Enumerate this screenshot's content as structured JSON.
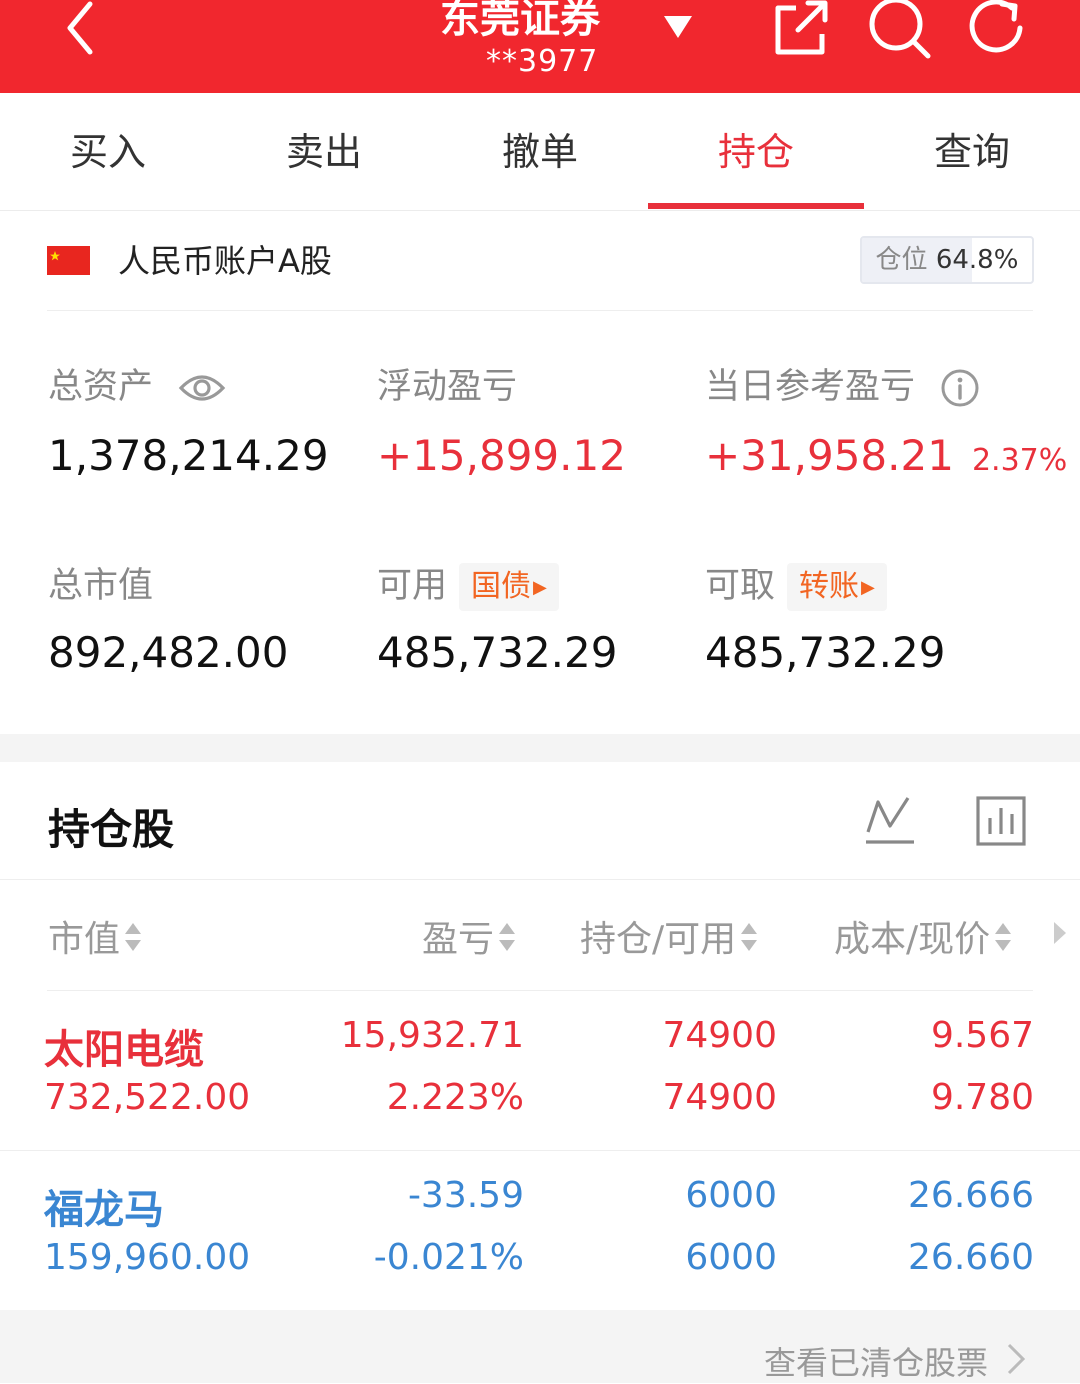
{
  "header": {
    "broker": "东莞证券",
    "account": "**3977",
    "colors": {
      "bar": "#f1272e",
      "accent": "#e8303b",
      "loss": "#3a86d2"
    },
    "icons": [
      "back-arrow-icon",
      "dropdown-triangle-icon",
      "share-icon",
      "search-icon",
      "refresh-icon"
    ]
  },
  "tabs": [
    {
      "label": "买入"
    },
    {
      "label": "卖出"
    },
    {
      "label": "撤单"
    },
    {
      "label": "持仓"
    },
    {
      "label": "查询"
    }
  ],
  "active_tab": "持仓",
  "account": {
    "label": "人民币账户A股",
    "position_label": "仓位",
    "position_value": "64.8%",
    "position_fraction": 0.648
  },
  "summary": {
    "total_assets": {
      "label": "总资产",
      "value": "1,378,214.29"
    },
    "floating_pl": {
      "label": "浮动盈亏",
      "value": "+15,899.12"
    },
    "daily_pl": {
      "label": "当日参考盈亏",
      "value": "+31,958.21",
      "pct": "2.37%"
    },
    "market_value": {
      "label": "总市值",
      "value": "892,482.00"
    },
    "available": {
      "label": "可用",
      "tag": "国债",
      "value": "485,732.29"
    },
    "withdrawable": {
      "label": "可取",
      "tag": "转账",
      "value": "485,732.29"
    }
  },
  "holdings": {
    "title": "持仓股",
    "columns": [
      "市值",
      "盈亏",
      "持仓/可用",
      "成本/现价"
    ],
    "rows": [
      {
        "name": "太阳电缆",
        "market_value": "732,522.00",
        "pl": "15,932.71",
        "pl_pct": "2.223%",
        "position": "74900",
        "available": "74900",
        "cost": "9.567",
        "price": "9.780",
        "trend": "gain"
      },
      {
        "name": "福龙马",
        "market_value": "159,960.00",
        "pl": "-33.59",
        "pl_pct": "-0.021%",
        "position": "6000",
        "available": "6000",
        "cost": "26.666",
        "price": "26.660",
        "trend": "loss"
      }
    ]
  },
  "footer": {
    "link": "查看已清仓股票"
  }
}
